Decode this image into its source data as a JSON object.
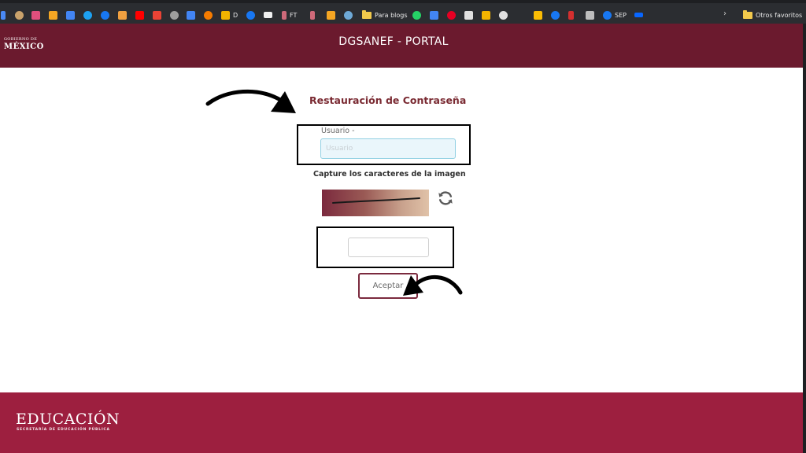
{
  "bookmarks_bar": {
    "items": [
      {
        "icon": "app-icon",
        "color": "#4a8af4",
        "label": ""
      },
      {
        "icon": "circle-icon",
        "color": "#c9a26b",
        "label": ""
      },
      {
        "icon": "pink-icon",
        "color": "#e04f7d",
        "label": ""
      },
      {
        "icon": "analytics-icon",
        "color": "#f5a623",
        "label": ""
      },
      {
        "icon": "ads-icon",
        "color": "#4285f4",
        "label": ""
      },
      {
        "icon": "twitter-icon",
        "color": "#1da1f2",
        "label": ""
      },
      {
        "icon": "facebook-icon",
        "color": "#1877f2",
        "label": ""
      },
      {
        "icon": "pencil-icon",
        "color": "#f0a040",
        "label": ""
      },
      {
        "icon": "youtube-icon",
        "color": "#ff0000",
        "label": ""
      },
      {
        "icon": "gmail-icon",
        "color": "#ea4335",
        "label": ""
      },
      {
        "icon": "gray-icon",
        "color": "#9e9e9e",
        "label": ""
      },
      {
        "icon": "calendar-icon",
        "color": "#4285f4",
        "label": ""
      },
      {
        "icon": "link-icon",
        "color": "#f57c00",
        "label": ""
      },
      {
        "icon": "doc-icon",
        "color": "#f0b400",
        "label": "D"
      },
      {
        "icon": "facebook-icon",
        "color": "#1877f2",
        "label": ""
      },
      {
        "icon": "ft-icon",
        "color": "#f0f0f0",
        "label": ""
      },
      {
        "icon": "fiverr-icon",
        "color": "#ce6a7a",
        "label": "FT"
      },
      {
        "icon": "fiverr-icon",
        "color": "#ce6a7a",
        "label": ""
      },
      {
        "icon": "analytics-icon",
        "color": "#f5a623",
        "label": ""
      },
      {
        "icon": "wordpress-icon",
        "color": "#6ea9d6",
        "label": ""
      },
      {
        "icon": "folder-icon",
        "color": "#f2c94c",
        "label": "Para blogs"
      },
      {
        "icon": "whatsapp-icon",
        "color": "#25d366",
        "label": ""
      },
      {
        "icon": "docs-icon",
        "color": "#4285f4",
        "label": ""
      },
      {
        "icon": "pinterest-icon",
        "color": "#e60023",
        "label": ""
      },
      {
        "icon": "code-icon",
        "color": "#e0e0e0",
        "label": ""
      },
      {
        "icon": "keep-icon",
        "color": "#f4b400",
        "label": ""
      },
      {
        "icon": "github-icon",
        "color": "#e0e0e0",
        "label": ""
      },
      {
        "icon": "drive-icon",
        "color": "#fbbc04",
        "label": ""
      },
      {
        "icon": "facebook-icon",
        "color": "#1877f2",
        "label": ""
      },
      {
        "icon": "flag-icon",
        "color": "#d32f2f",
        "label": ""
      },
      {
        "icon": "camera-icon",
        "color": "#bdbdbd",
        "label": ""
      },
      {
        "icon": "facebook-icon",
        "color": "#1877f2",
        "label": "SEP"
      },
      {
        "icon": "meta-icon",
        "color": "#0866ff",
        "label": ""
      }
    ],
    "other_favorites": "Otros favoritos"
  },
  "header": {
    "logo_top": "GOBIERNO DE",
    "logo_bottom": "MÉXICO",
    "title": "DGSANEF - PORTAL",
    "background": "#6b1a2e"
  },
  "form": {
    "title": "Restauración de Contraseña",
    "username_label": "Usuario -",
    "username_value": "",
    "username_placeholder": "Usuario",
    "captcha_instruction": "Capture los caracteres de la imagen",
    "captcha_value": "",
    "accept_label": "Aceptar",
    "accent_color": "#7b2a3e"
  },
  "footer": {
    "title": "EDUCACIÓN",
    "subtitle": "SECRETARÍA DE EDUCACIÓN PÚBLICA",
    "background": "#9d1f3f"
  }
}
